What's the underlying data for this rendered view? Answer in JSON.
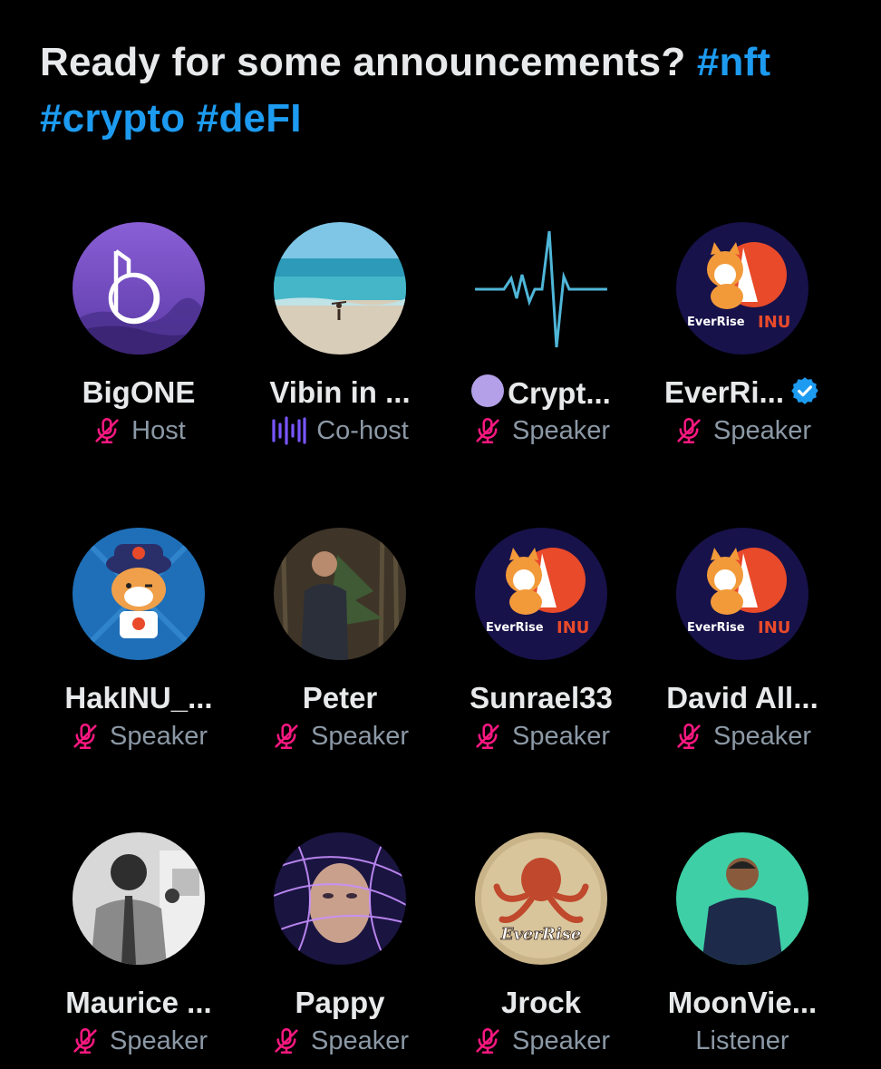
{
  "space": {
    "title_text": "Ready for some announcements? ",
    "hashtags": [
      "#nft",
      "#crypto",
      "#deFI"
    ]
  },
  "participants": [
    {
      "name": "BigONE",
      "role": "Host",
      "mic_icon": "mic-muted-icon",
      "avatar": "bigone-logo"
    },
    {
      "name": "Vibin in ...",
      "role": "Co-host",
      "mic_icon": "speaking-wave-icon",
      "avatar": "beach-photo"
    },
    {
      "name": "Crypt...",
      "role": "Speaker",
      "mic_icon": "mic-muted-icon",
      "avatar": "heartbeat-line",
      "emoji": "purple-circle"
    },
    {
      "name": "EverRi...",
      "role": "Speaker",
      "mic_icon": "mic-muted-icon",
      "avatar": "everrise-inu-logo",
      "verified": true
    },
    {
      "name": "HakINU_...",
      "role": "Speaker",
      "mic_icon": "mic-muted-icon",
      "avatar": "shiba-cartoon"
    },
    {
      "name": "Peter",
      "role": "Speaker",
      "mic_icon": "mic-muted-icon",
      "avatar": "man-in-woods-photo"
    },
    {
      "name": "Sunrael33",
      "role": "Speaker",
      "mic_icon": "mic-muted-icon",
      "avatar": "everrise-inu-logo"
    },
    {
      "name": "David All...",
      "role": "Speaker",
      "mic_icon": "mic-muted-icon",
      "avatar": "everrise-inu-logo"
    },
    {
      "name": "Maurice ...",
      "role": "Speaker",
      "mic_icon": "mic-muted-icon",
      "avatar": "bw-portrait-photo"
    },
    {
      "name": "Pappy",
      "role": "Speaker",
      "mic_icon": "mic-muted-icon",
      "avatar": "neon-face-art"
    },
    {
      "name": "Jrock",
      "role": "Speaker",
      "mic_icon": "mic-muted-icon",
      "avatar": "everrise-octopus-logo"
    },
    {
      "name": "MoonVie...",
      "role": "Listener",
      "mic_icon": "",
      "avatar": "man-teal-background-photo"
    }
  ],
  "everrise_logo_text": {
    "ever": "EverRise",
    "inu": "INU"
  },
  "octopus_logo_text": "EverRise",
  "colors": {
    "background": "#000000",
    "hashtag": "#1d9bf0",
    "mic_muted": "#f91880",
    "speaking_wave": "#7856ff",
    "verified": "#1d9bf0",
    "role_text": "#8b98a5"
  }
}
